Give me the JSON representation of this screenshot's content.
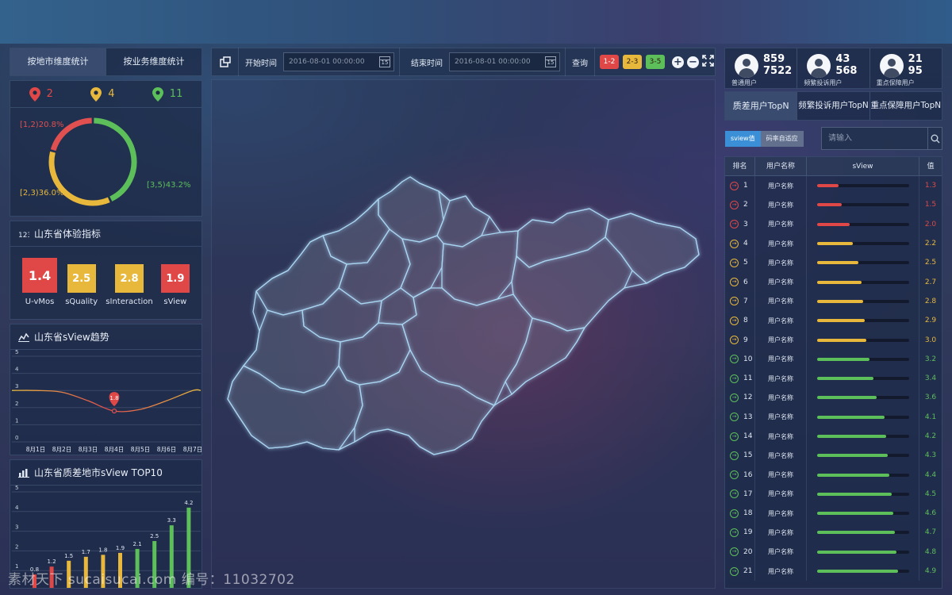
{
  "left_tabs": [
    "按地市维度统计",
    "按业务维度统计"
  ],
  "pins": [
    {
      "count": "2",
      "color": "#e04848"
    },
    {
      "count": "4",
      "color": "#e8b83c"
    },
    {
      "count": "11",
      "color": "#5cbf5a"
    }
  ],
  "donut": {
    "segments": [
      {
        "label": "[1,2)20.8%",
        "percent": 20.8,
        "color": "#e05050"
      },
      {
        "label": "[2,3)36.0%",
        "percent": 36.0,
        "color": "#e8b83c"
      },
      {
        "label": "[3,5)43.2%",
        "percent": 43.2,
        "color": "#5cbf5a"
      }
    ]
  },
  "experience": {
    "title": "山东省体验指标",
    "items": [
      {
        "value": "1.4",
        "label": "U-vMos",
        "color": "#e04848"
      },
      {
        "value": "2.5",
        "label": "sQuality",
        "color": "#e8b83c"
      },
      {
        "value": "2.8",
        "label": "sInteraction",
        "color": "#e8b83c"
      },
      {
        "value": "1.9",
        "label": "sView",
        "color": "#e04848"
      }
    ]
  },
  "trend_panel": {
    "title": "山东省sView趋势"
  },
  "top10_panel": {
    "title": "山东省质差地市sView TOP10"
  },
  "chart_data": [
    {
      "type": "line",
      "title": "山东省sView趋势",
      "categories": [
        "8月1日",
        "8月2日",
        "8月3日",
        "8月4日",
        "8月5日",
        "8月6日",
        "8月7日"
      ],
      "values": [
        3.0,
        2.9,
        2.4,
        1.8,
        1.9,
        2.4,
        3.0
      ],
      "marker": {
        "category": "8月4日",
        "value": 1.8,
        "label": "1.8"
      },
      "ylim": [
        0,
        5
      ],
      "yticks": [
        "0",
        "1",
        "2",
        "3",
        "4",
        "5"
      ],
      "grid": true
    },
    {
      "type": "bar",
      "title": "山东省质差地市sView TOP10",
      "values": [
        0.8,
        1.2,
        1.5,
        1.7,
        1.8,
        1.9,
        2.1,
        2.5,
        3.3,
        4.2
      ],
      "value_labels": [
        "0.8",
        "1.2",
        "1.5",
        "1.7",
        "1.8",
        "1.9",
        "2.1",
        "2.5",
        "3.3",
        "4.2"
      ],
      "colors": [
        "#e04848",
        "#e04848",
        "#e8b83c",
        "#e8b83c",
        "#e8b83c",
        "#e8b83c",
        "#5cbf5a",
        "#5cbf5a",
        "#5cbf5a",
        "#5cbf5a"
      ],
      "ylim": [
        0,
        5
      ],
      "yticks": [
        "1",
        "2",
        "3",
        "4",
        "5"
      ],
      "grid": true
    }
  ],
  "toolbar": {
    "start_label": "开始时间",
    "start_value": "2016-08-01  00:00:00",
    "end_label": "结束时间",
    "end_value": "2016-08-01  00:00:00",
    "calendar_day": "15",
    "query_label": "查询",
    "chips": [
      {
        "label": "1-2",
        "color": "#e04848"
      },
      {
        "label": "2-3",
        "color": "#e8b83c"
      },
      {
        "label": "3-5",
        "color": "#5cbf5a"
      }
    ]
  },
  "stats": [
    {
      "line1": "859",
      "line2": "7522",
      "label": "普通用户"
    },
    {
      "line1": "43",
      "line2": "568",
      "label": "频繁投诉用户"
    },
    {
      "line1": "21",
      "line2": "95",
      "label": "重点保障用户"
    }
  ],
  "right_tabs": [
    "质差用户TopN",
    "频繁投诉用户TopN",
    "重点保障用户TopN"
  ],
  "segment": {
    "on": "sview值",
    "off": "码率自适应"
  },
  "search": {
    "placeholder": "请输入"
  },
  "rank_table": {
    "headers": [
      "排名",
      "用户名称",
      "sView",
      "值"
    ],
    "rows": [
      {
        "rank": "1",
        "name": "用户名称",
        "value": "1.3",
        "score": 1.3,
        "color": "#e04848"
      },
      {
        "rank": "2",
        "name": "用户名称",
        "value": "1.5",
        "score": 1.5,
        "color": "#e04848"
      },
      {
        "rank": "3",
        "name": "用户名称",
        "value": "2.0",
        "score": 2.0,
        "color": "#e04848"
      },
      {
        "rank": "4",
        "name": "用户名称",
        "value": "2.2",
        "score": 2.2,
        "color": "#e8b83c"
      },
      {
        "rank": "5",
        "name": "用户名称",
        "value": "2.5",
        "score": 2.5,
        "color": "#e8b83c"
      },
      {
        "rank": "6",
        "name": "用户名称",
        "value": "2.7",
        "score": 2.7,
        "color": "#e8b83c"
      },
      {
        "rank": "7",
        "name": "用户名称",
        "value": "2.8",
        "score": 2.8,
        "color": "#e8b83c"
      },
      {
        "rank": "8",
        "name": "用户名称",
        "value": "2.9",
        "score": 2.9,
        "color": "#e8b83c"
      },
      {
        "rank": "9",
        "name": "用户名称",
        "value": "3.0",
        "score": 3.0,
        "color": "#e8b83c"
      },
      {
        "rank": "10",
        "name": "用户名称",
        "value": "3.2",
        "score": 3.2,
        "color": "#5cbf5a"
      },
      {
        "rank": "11",
        "name": "用户名称",
        "value": "3.4",
        "score": 3.4,
        "color": "#5cbf5a"
      },
      {
        "rank": "12",
        "name": "用户名称",
        "value": "3.6",
        "score": 3.6,
        "color": "#5cbf5a"
      },
      {
        "rank": "13",
        "name": "用户名称",
        "value": "4.1",
        "score": 4.1,
        "color": "#5cbf5a"
      },
      {
        "rank": "14",
        "name": "用户名称",
        "value": "4.2",
        "score": 4.2,
        "color": "#5cbf5a"
      },
      {
        "rank": "15",
        "name": "用户名称",
        "value": "4.3",
        "score": 4.3,
        "color": "#5cbf5a"
      },
      {
        "rank": "16",
        "name": "用户名称",
        "value": "4.4",
        "score": 4.4,
        "color": "#5cbf5a"
      },
      {
        "rank": "17",
        "name": "用户名称",
        "value": "4.5",
        "score": 4.5,
        "color": "#5cbf5a"
      },
      {
        "rank": "18",
        "name": "用户名称",
        "value": "4.6",
        "score": 4.6,
        "color": "#5cbf5a"
      },
      {
        "rank": "19",
        "name": "用户名称",
        "value": "4.7",
        "score": 4.7,
        "color": "#5cbf5a"
      },
      {
        "rank": "20",
        "name": "用户名称",
        "value": "4.8",
        "score": 4.8,
        "color": "#5cbf5a"
      },
      {
        "rank": "21",
        "name": "用户名称",
        "value": "4.9",
        "score": 4.9,
        "color": "#5cbf5a"
      }
    ]
  },
  "watermark": "素材天下 sucaisucai.com  编号：11032702"
}
